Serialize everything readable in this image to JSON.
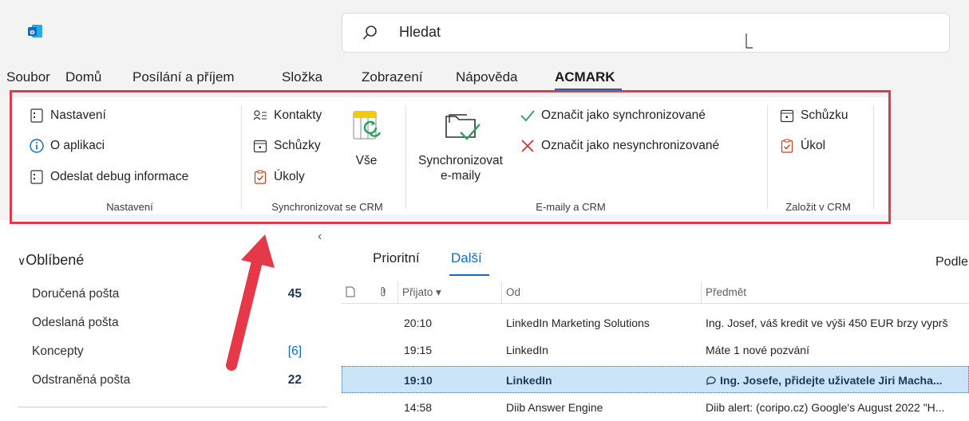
{
  "search": {
    "value": "Hledat"
  },
  "menu": {
    "items": [
      "Soubor",
      "Domů",
      "Posílání a příjem",
      "Složka",
      "Zobrazení",
      "Nápověda",
      "ACMARK"
    ],
    "active": "ACMARK"
  },
  "ribbon": {
    "nastaveni": {
      "settings": "Nastavení",
      "about": "O aplikaci",
      "debug": "Odeslat debug informace",
      "label": "Nastavení"
    },
    "sync": {
      "contacts": "Kontakty",
      "meetings": "Schůzky",
      "tasks": "Úkoly",
      "all": "Vše",
      "label": "Synchronizovat se CRM"
    },
    "emails": {
      "sync_line1": "Synchronizovat",
      "sync_line2": "e-maily",
      "mark_synced": "Označit jako synchronizované",
      "mark_unsynced": "Označit jako nesynchronizované",
      "label": "E-maily a CRM"
    },
    "create": {
      "meeting": "Schůzku",
      "task": "Úkol",
      "label": "Založit v CRM"
    }
  },
  "folders": {
    "favorites": "Oblíbené",
    "items": [
      {
        "name": "Doručená pošta",
        "count": "45"
      },
      {
        "name": "Odeslaná pošta",
        "count": ""
      },
      {
        "name": "Koncepty",
        "count": "[6]"
      },
      {
        "name": "Odstraněná pošta",
        "count": "22"
      }
    ]
  },
  "list": {
    "tabs": [
      "Prioritní",
      "Další"
    ],
    "sort_label": "Podle",
    "columns": {
      "received": "Přijato",
      "from": "Od",
      "subject": "Předmět"
    },
    "rows": [
      {
        "time": "20:10",
        "from": "LinkedIn Marketing Solutions",
        "subject": "Ing. Josef, váš kredit ve výši 450 EUR brzy vyprš"
      },
      {
        "time": "19:15",
        "from": "LinkedIn",
        "subject": "Máte 1 nové pozvání"
      },
      {
        "time": "19:10",
        "from": "LinkedIn",
        "subject": "Ing. Josefe, přidejte uživatele Jiri Macha..."
      },
      {
        "time": "14:58",
        "from": "Diib Answer Engine",
        "subject": "Diib alert: (coripo.cz) Google's August 2022 \"H..."
      }
    ]
  },
  "colors": {
    "accent": "#0f6cbd",
    "highlight_red": "#e5394a",
    "selected_row": "#cce4f7"
  }
}
